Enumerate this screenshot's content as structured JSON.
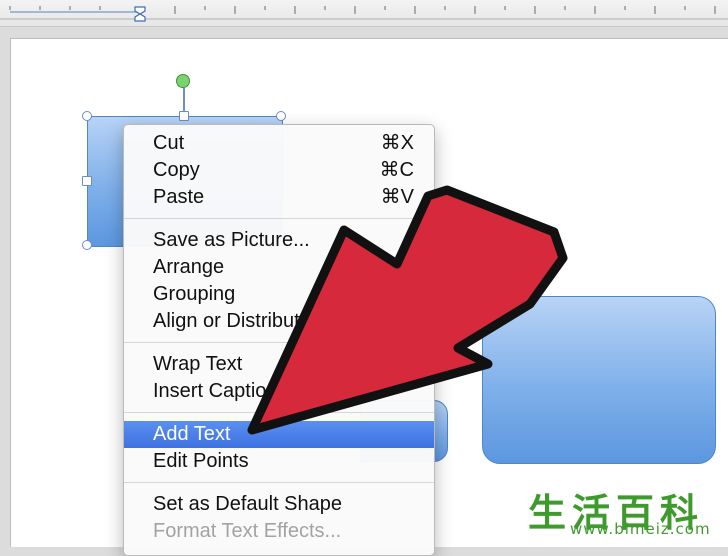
{
  "menu": {
    "groups": [
      [
        {
          "label": "Cut",
          "shortcut": "⌘X"
        },
        {
          "label": "Copy",
          "shortcut": "⌘C"
        },
        {
          "label": "Paste",
          "shortcut": "⌘V"
        }
      ],
      [
        {
          "label": "Save as Picture..."
        },
        {
          "label": "Arrange"
        },
        {
          "label": "Grouping"
        },
        {
          "label": "Align or Distribute"
        }
      ],
      [
        {
          "label": "Wrap Text"
        },
        {
          "label": "Insert Caption"
        }
      ],
      [
        {
          "label": "Add Text",
          "state": "highlighted"
        },
        {
          "label": "Edit Points"
        }
      ],
      [
        {
          "label": "Set as Default Shape"
        },
        {
          "label": "Format Text Effects...",
          "state": "disabled"
        }
      ]
    ]
  },
  "colors": {
    "arrow_fill": "#d62a3c",
    "highlight": "#4a7fe8",
    "shape_fill": "#7fb0ea",
    "watermark": "#3f9a2e"
  },
  "watermark": {
    "logo_text": "生活百科",
    "url": "www.bimeiz.com"
  }
}
